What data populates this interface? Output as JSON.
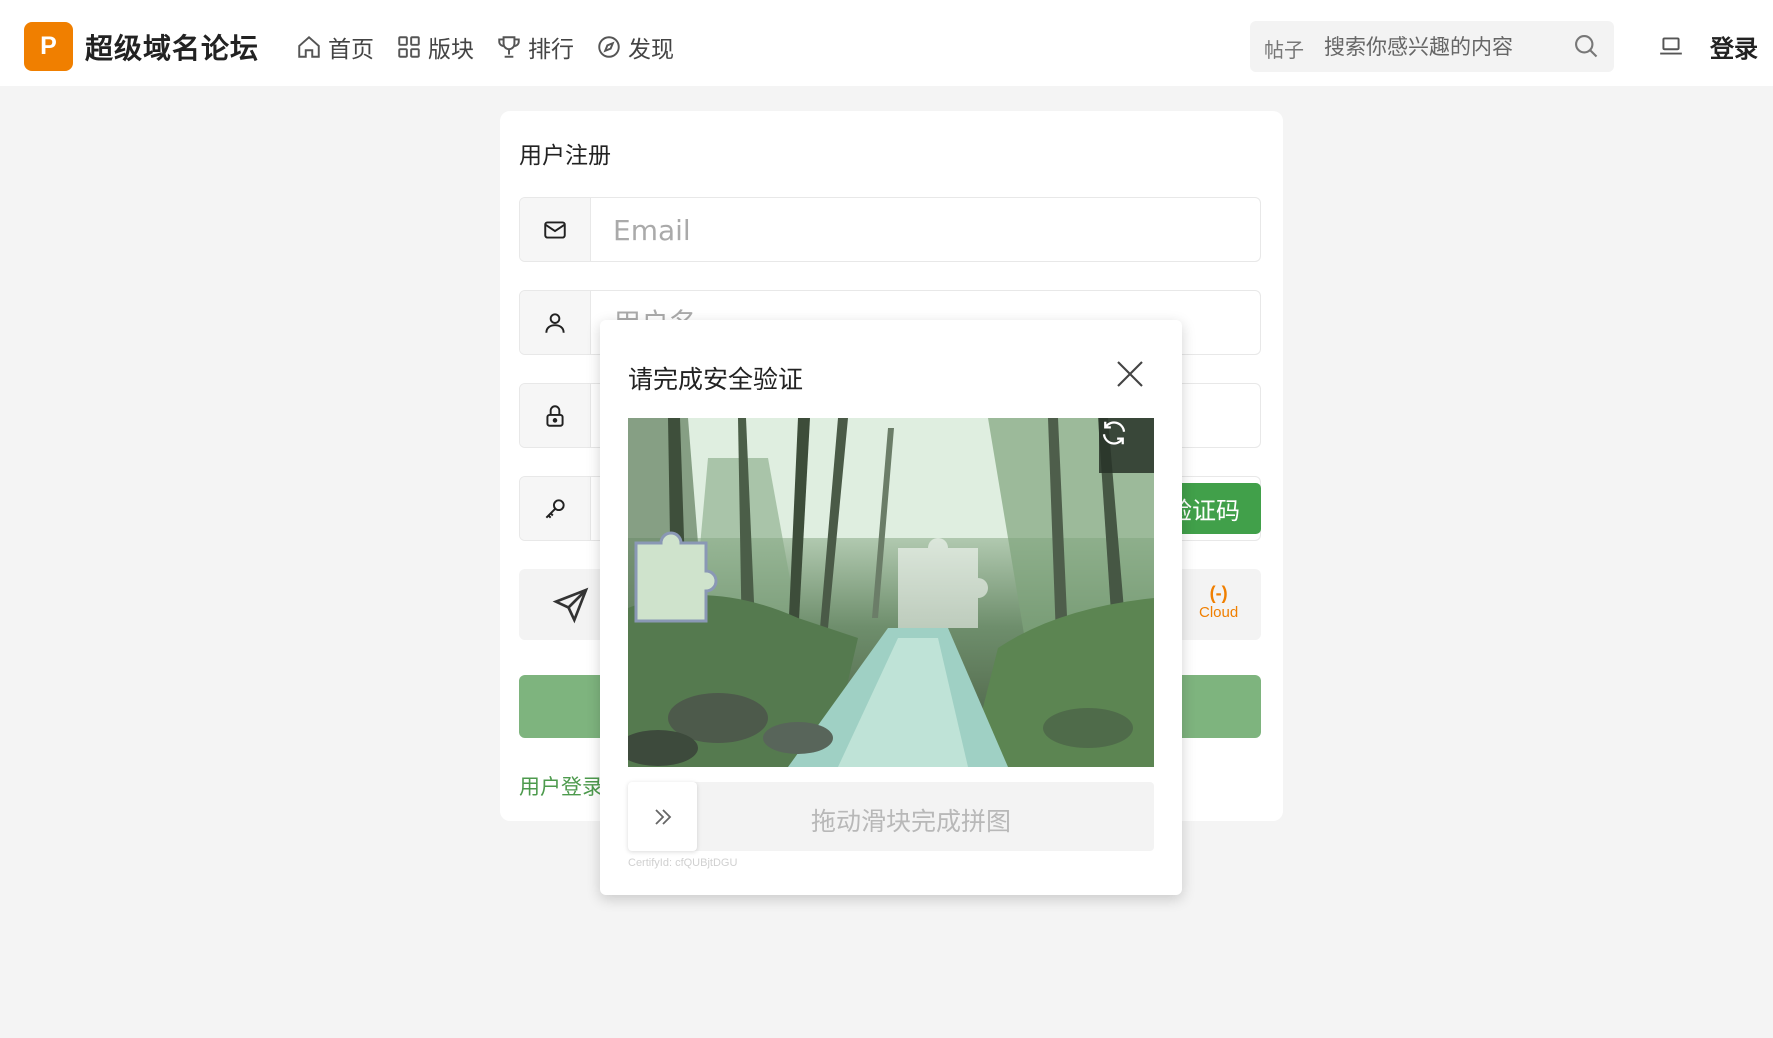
{
  "header": {
    "logo_letter": "P",
    "site_name": "超级域名论坛",
    "nav": [
      {
        "label": "首页",
        "icon": "home-icon"
      },
      {
        "label": "版块",
        "icon": "grid-icon"
      },
      {
        "label": "排行",
        "icon": "trophy-icon"
      },
      {
        "label": "发现",
        "icon": "compass-icon"
      }
    ],
    "search": {
      "type_label": "帖子",
      "placeholder": "搜索你感兴趣的内容"
    },
    "login_label": "登录"
  },
  "register": {
    "title": "用户注册",
    "email_placeholder": "Email",
    "username_placeholder": "用户名",
    "code_button_label": "验证码",
    "captcha_brand": "Cloud",
    "login_link_label": "用户登录"
  },
  "captcha_modal": {
    "title": "请完成安全验证",
    "slider_text": "拖动滑块完成拼图",
    "certify_id": "CertifyId: cfQUBjtDGU"
  },
  "colors": {
    "brand_orange": "#f07f00",
    "accent_green": "#41a04a",
    "submit_green": "#7eb47e"
  }
}
